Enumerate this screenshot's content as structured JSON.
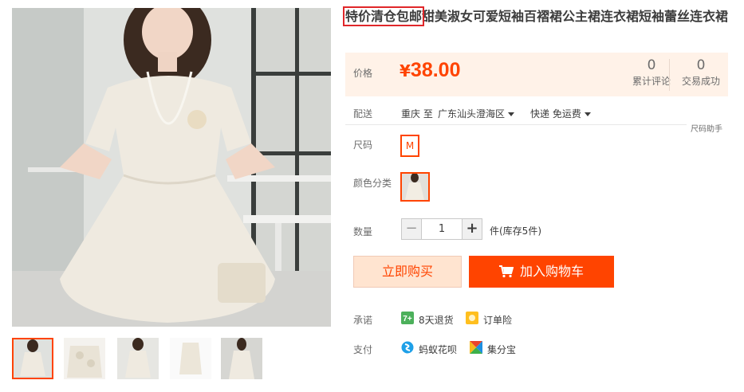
{
  "product": {
    "title_highlight": "特价清仓包邮",
    "title_rest": "甜美淑女可爱短袖百褶裙公主裙连衣裙短袖蕾丝连衣裙"
  },
  "price": {
    "label": "价格",
    "currency": "¥",
    "value": "38.00",
    "reviews_count": "0",
    "reviews_label": "累计评论",
    "sales_count": "0",
    "sales_label": "交易成功"
  },
  "shipping": {
    "label": "配送",
    "from": "重庆 至",
    "to": "广东汕头澄海区",
    "method": "快递 免运费",
    "size_help": "尺码助手"
  },
  "size": {
    "label": "尺码",
    "options": [
      "M"
    ]
  },
  "color": {
    "label": "颜色分类"
  },
  "quantity": {
    "label": "数量",
    "minus": "−",
    "value": "1",
    "plus": "+",
    "stock": "件(库存5件)"
  },
  "actions": {
    "buy_now": "立即购买",
    "add_to_cart": "加入购物车"
  },
  "promise": {
    "label": "承诺",
    "return": "8天退货",
    "insurance": "订单险"
  },
  "payment": {
    "label": "支付",
    "huabei": "蚂蚁花呗",
    "jifenbao": "集分宝"
  },
  "icons": {
    "cart": "cart-icon",
    "return": "7plus-return-icon",
    "insurance": "insurance-icon",
    "huabei": "huabei-icon",
    "jifenbao": "jifenbao-icon"
  },
  "colors": {
    "accent": "#ff4400",
    "price_bg": "#fff2e8",
    "buy_bg": "#ffe4d0"
  }
}
